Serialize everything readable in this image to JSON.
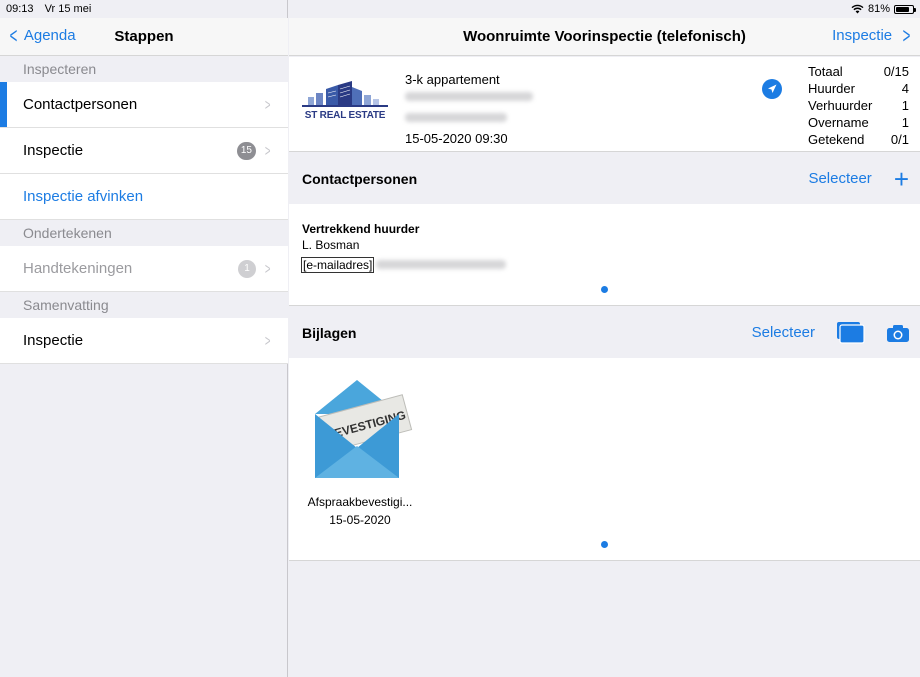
{
  "status": {
    "time": "09:13",
    "date": "Vr 15 mei",
    "battery": "81%",
    "battery_level": 0.81
  },
  "sidebar": {
    "back_label": "Agenda",
    "title": "Stappen",
    "sections": [
      {
        "header": "Inspecteren"
      },
      {
        "header": "Ondertekenen"
      },
      {
        "header": "Samenvatting"
      }
    ],
    "items": [
      {
        "label": "Contactpersonen"
      },
      {
        "label": "Inspectie",
        "badge": "15"
      },
      {
        "label": "Inspectie afvinken"
      },
      {
        "label": "Handtekeningen",
        "badge": "1"
      },
      {
        "label": "Inspectie"
      }
    ]
  },
  "main": {
    "title": "Woonruimte Voorinspectie (telefonisch)",
    "forward_label": "Inspectie",
    "info": {
      "logo_text": "ST REAL ESTATE",
      "property_type": "3-k appartement",
      "datetime": "15-05-2020 09:30",
      "stats": [
        {
          "label": "Totaal",
          "value": "0/15"
        },
        {
          "label": "Huurder",
          "value": "4"
        },
        {
          "label": "Verhuurder",
          "value": "1"
        },
        {
          "label": "Overname",
          "value": "1"
        },
        {
          "label": "Getekend",
          "value": "0/1"
        }
      ]
    },
    "contacts": {
      "header": "Contactpersonen",
      "select_label": "Selecteer",
      "add_label": "+",
      "role": "Vertrekkend huurder",
      "name": "L. Bosman",
      "email_label": "[e-mailadres]"
    },
    "attachments": {
      "header": "Bijlagen",
      "select_label": "Selecteer",
      "envelope_text": "BEVESTIGING",
      "item_name": "Afspraakbevestigi...",
      "item_date": "15-05-2020"
    }
  },
  "colors": {
    "accent": "#1c7ce3",
    "background": "#efeff4",
    "envelope": "#3d9ad6"
  }
}
